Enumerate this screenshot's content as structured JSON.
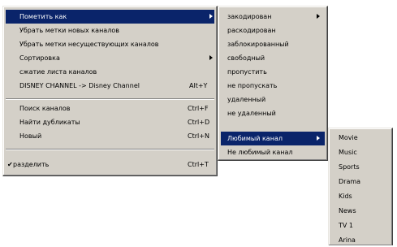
{
  "main_menu": {
    "items": [
      {
        "label": "Пометить как"
      },
      {
        "label": "Убрать метки новых каналов"
      },
      {
        "label": "Убрать метки несуществующих каналов"
      },
      {
        "label": "Сортировка"
      },
      {
        "label": "сжатие листа каналов"
      },
      {
        "label": "DISNEY CHANNEL -> Disney Channel",
        "shortcut": "Alt+Y"
      },
      {
        "label": "Поиск каналов",
        "shortcut": "Ctrl+F"
      },
      {
        "label": "Найти дубликаты",
        "shortcut": "Ctrl+D"
      },
      {
        "label": "Новый",
        "shortcut": "Ctrl+N"
      },
      {
        "label": "разделить",
        "shortcut": "Ctrl+T",
        "check": "✔"
      }
    ]
  },
  "mark_submenu": {
    "items": [
      {
        "label": "закодирован"
      },
      {
        "label": "раскодирован"
      },
      {
        "label": "заблокированный"
      },
      {
        "label": "свободный"
      },
      {
        "label": "пропустить"
      },
      {
        "label": "не пропускать"
      },
      {
        "label": "удаленный"
      },
      {
        "label": "не удаленный"
      },
      {
        "label": "Любимый канал"
      },
      {
        "label": "Не любимый канал"
      }
    ]
  },
  "favorite_submenu": {
    "items": [
      {
        "label": "Movie"
      },
      {
        "label": "Music"
      },
      {
        "label": "Sports"
      },
      {
        "label": "Drama"
      },
      {
        "label": "Kids"
      },
      {
        "label": "News"
      },
      {
        "label": "TV 1"
      },
      {
        "label": "Arina"
      }
    ]
  },
  "colors": {
    "menu_bg": "#d4d0c8",
    "highlight": "#0a246a",
    "highlight_text": "#ffffff"
  }
}
